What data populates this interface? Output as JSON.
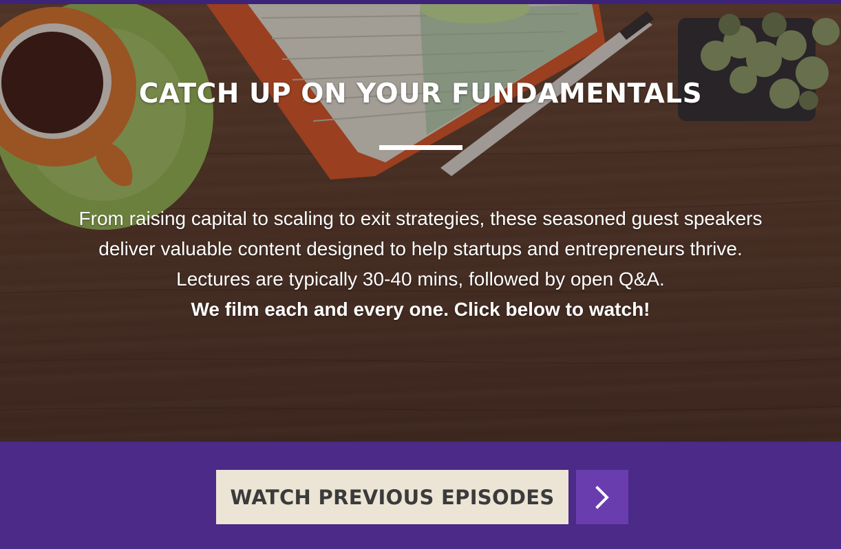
{
  "hero": {
    "title": "CATCH UP ON YOUR FUNDAMENTALS",
    "description": "From raising capital to scaling to exit strategies, these seasoned guest speakers deliver valuable content designed to help startups and entrepreneurs thrive. Lectures are typically 30-40 mins, followed by open Q&A.",
    "cta_text": "We film each and every one. Click below to watch!"
  },
  "actions": {
    "watch_label": "WATCH PREVIOUS EPISODES",
    "arrow_icon": "chevron-right-icon"
  },
  "colors": {
    "band": "#4b2a88",
    "button_bg": "#ece5d6",
    "arrow_bg": "#6a3dae",
    "text": "#ffffff"
  }
}
